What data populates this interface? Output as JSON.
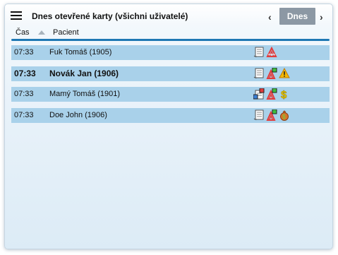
{
  "header": {
    "title": "Dnes otevřené karty (všichni uživatelé)",
    "today_button": "Dnes",
    "prev_glyph": "‹",
    "next_glyph": "›"
  },
  "columns": {
    "time": "Čas",
    "patient": "Pacient"
  },
  "rows": [
    {
      "time": "07:33",
      "patient": "Fuk Tomáš (1905)",
      "bold": false,
      "icons": [
        "document-icon",
        "allergy-icon"
      ]
    },
    {
      "time": "07:33",
      "patient": "Novák Jan (1906)",
      "bold": true,
      "icons": [
        "document-icon",
        "allergy-flag-icon",
        "warning-icon"
      ]
    },
    {
      "time": "07:33",
      "patient": "Mamý Tomáš (1901)",
      "bold": false,
      "icons": [
        "document-flag-icon",
        "allergy-flag-icon",
        "money-icon"
      ]
    },
    {
      "time": "07:33",
      "patient": "Doe John (1906)",
      "bold": false,
      "icons": [
        "document-icon",
        "allergy-flag-icon",
        "money-bag-icon"
      ]
    }
  ],
  "colors": {
    "row_bg": "#a9d1ea",
    "divider": "#1f78b4",
    "today_bg": "#8c98a4",
    "accent_red": "#e23b3b"
  }
}
